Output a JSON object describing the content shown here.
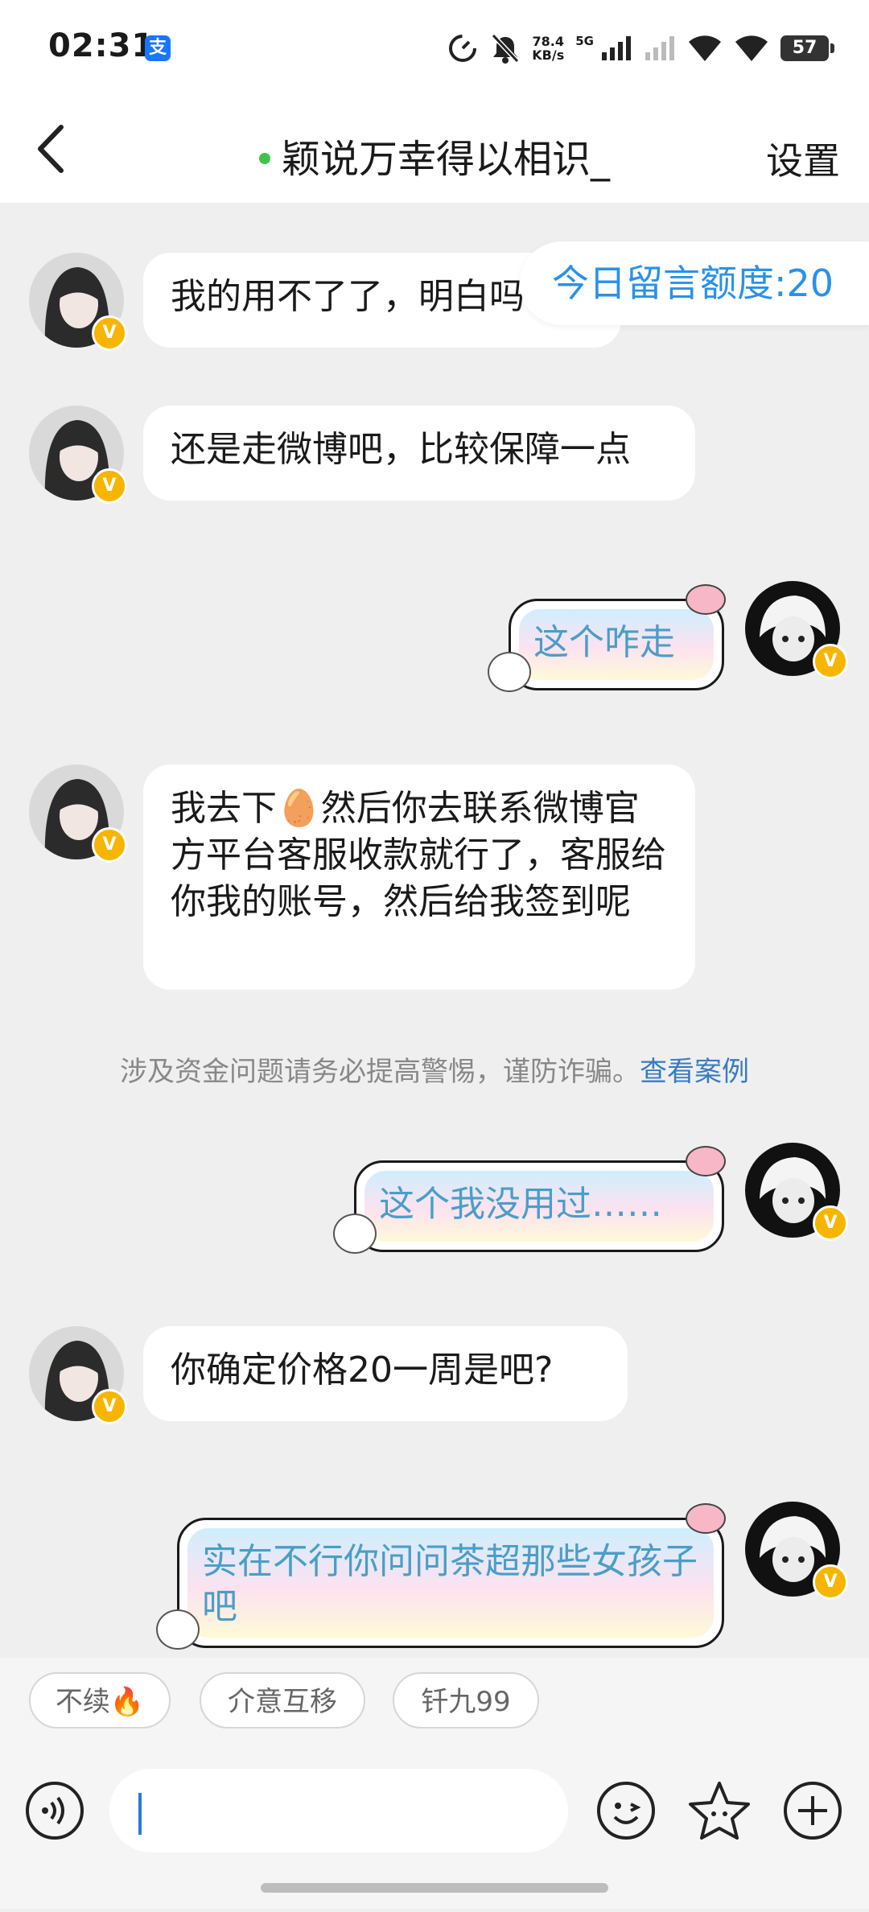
{
  "status_bar": {
    "time": "02:31",
    "alipay_icon": "支",
    "speed_value": "78.4",
    "speed_unit": "KB/s",
    "network": "5G",
    "battery": "57"
  },
  "header": {
    "title": "颖说万幸得以相识_",
    "settings_label": "设置"
  },
  "quota_banner": "今日留言额度:20",
  "messages": [
    {
      "side": "left",
      "text": "我的用不了了，明白吗"
    },
    {
      "side": "left",
      "text": "还是走微博吧，比较保障一点"
    },
    {
      "side": "right",
      "text": "这个咋走"
    },
    {
      "side": "left",
      "text": "我去下🥚然后你去联系微博官方平台客服收款就行了，客服给你我的账号，然后给我签到呢"
    },
    {
      "side": "right",
      "text": "这个我没用过……"
    },
    {
      "side": "left",
      "text": "你确定价格20一周是吧?"
    },
    {
      "side": "right",
      "text": "实在不行你问问茶超那些女孩子吧"
    }
  ],
  "warning": {
    "text": "涉及资金问题请务必提高警惕，谨防诈骗。",
    "link": "查看案例"
  },
  "quick_replies": [
    "不续🔥",
    "介意互移",
    "钎九99"
  ],
  "input": {
    "value": ""
  },
  "colors": {
    "accent_blue": "#2a91e8",
    "online_dot": "#3ec44a",
    "verified_badge": "#f7b500",
    "link": "#3a7bbf"
  },
  "icons": [
    "back-icon",
    "voice-icon",
    "emoji-icon",
    "sticker-icon",
    "plus-icon",
    "verified-icon"
  ]
}
